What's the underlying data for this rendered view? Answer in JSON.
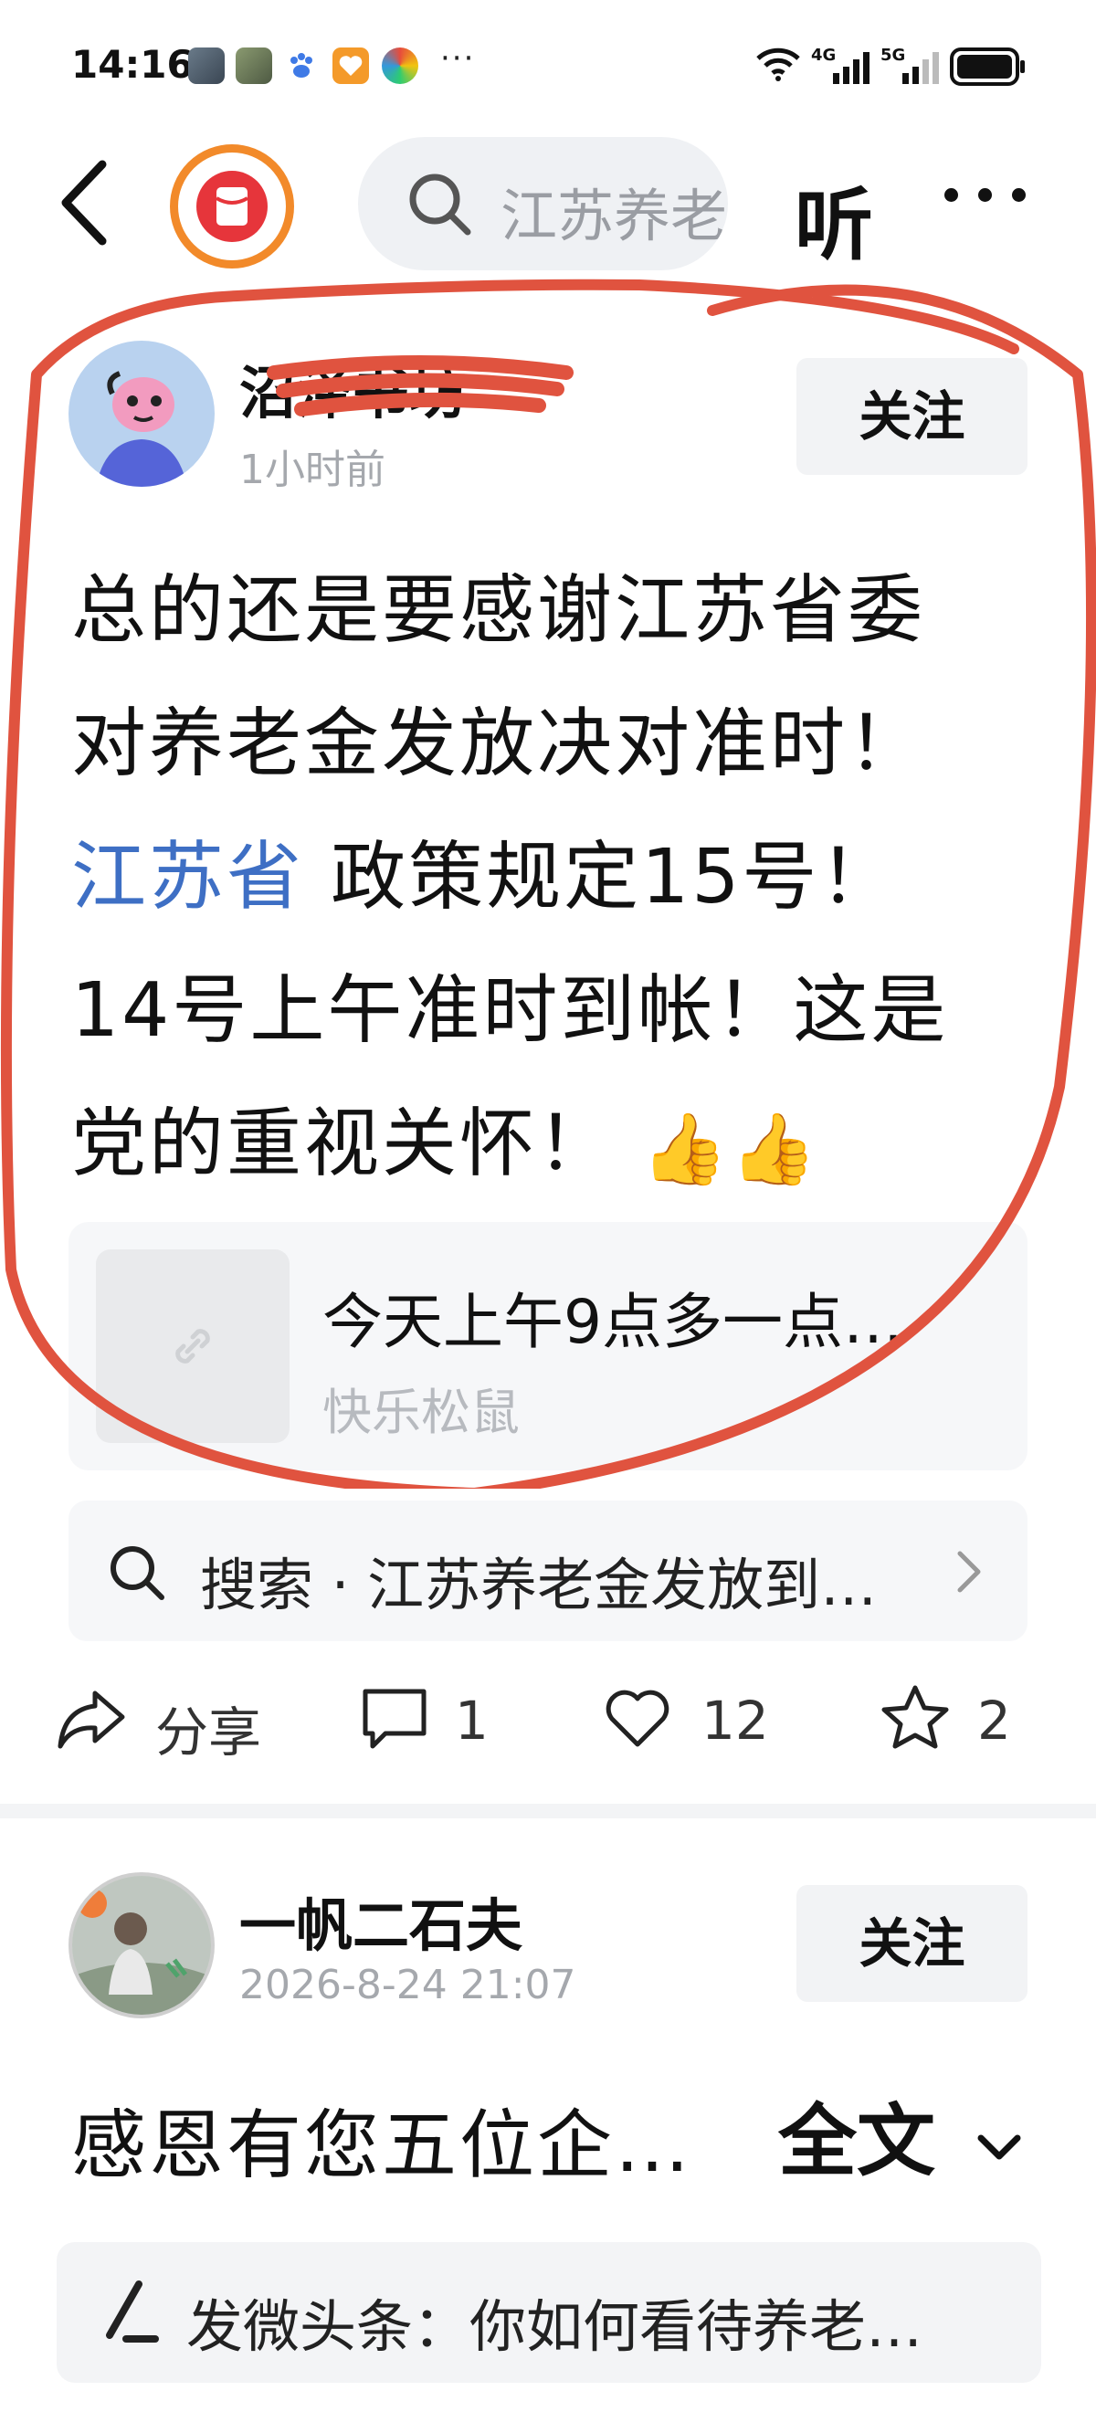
{
  "status_bar": {
    "time": "14:16",
    "more": "···",
    "network_1": "4G",
    "network_2": "5G"
  },
  "nav": {
    "search_text": "江苏养老金",
    "listen_label": "听"
  },
  "post1": {
    "author": "沼泽书坊",
    "time": "1小时前",
    "follow_label": "关注",
    "lines": [
      "总的还是要感谢江苏省委",
      "对养老金发放决对准时！"
    ],
    "line3_link": "江苏省",
    "line3_rest": "政策规定15号！",
    "line4": "14号上午准时到帐！这是",
    "line5": "党的重视关怀！",
    "emojis": "👍👍",
    "ref_card": {
      "title": "今天上午9点多一点…",
      "source": "快乐松鼠"
    },
    "search_suggestion": "搜索 · 江苏养老金发放到…",
    "actions": {
      "share": "分享",
      "comments": "1",
      "likes": "12",
      "favorites": "2"
    }
  },
  "post2": {
    "author": "一帆二石夫",
    "time": "2026-8-24 21:07",
    "follow_label": "关注",
    "preview": "感恩有您五位企…",
    "full_label": "全文",
    "compose_text": "发微头条：你如何看待养老…"
  },
  "colors": {
    "accent_blue": "#3e6fc4",
    "annotation_red": "#e0533f",
    "badge_orange": "#f28a2a"
  }
}
